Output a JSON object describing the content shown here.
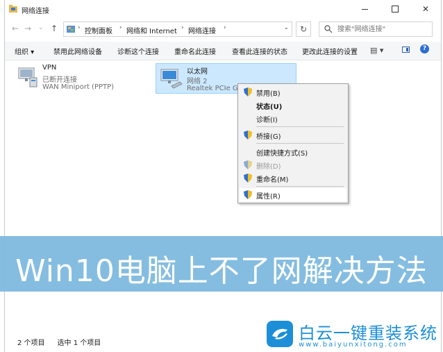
{
  "window": {
    "title": "网络连接",
    "controls": {
      "minimize": "min",
      "maximize": "max",
      "close": "✕"
    }
  },
  "nav": {
    "back": "←",
    "forward": "→",
    "recent": "⌄",
    "up": "↑",
    "breadcrumb": [
      "控制面板",
      "网络和 Internet",
      "网络连接"
    ],
    "refresh": "↻",
    "search_placeholder": "搜索\"网络连接\""
  },
  "commandbar": {
    "organize": "组织 ▾",
    "disable": "禁用此网络设备",
    "diagnose": "诊断这个连接",
    "rename": "重命名此连接",
    "view_status": "查看此连接的状态",
    "change_settings": "更改此连接的设置",
    "view_toggle": "▤ ▾",
    "help": "?"
  },
  "items": [
    {
      "name": "VPN",
      "status": "已断开连接",
      "device": "WAN Miniport (PPTP)",
      "selected": false
    },
    {
      "name": "以太网",
      "status": "网络 2",
      "device": "Realtek PCIe GB",
      "selected": true
    }
  ],
  "context_menu": {
    "items": [
      {
        "label": "禁用(B)",
        "shield": true,
        "bold": false,
        "disabled": false
      },
      {
        "label": "状态(U)",
        "shield": false,
        "bold": true,
        "disabled": false
      },
      {
        "label": "诊断(I)",
        "shield": false,
        "bold": false,
        "disabled": false
      },
      {
        "label": "桥接(G)",
        "shield": true,
        "bold": false,
        "disabled": false
      },
      {
        "label": "创建快捷方式(S)",
        "shield": false,
        "bold": false,
        "disabled": false
      },
      {
        "label": "删除(D)",
        "shield": true,
        "bold": false,
        "disabled": true
      },
      {
        "label": "重命名(M)",
        "shield": true,
        "bold": false,
        "disabled": false
      },
      {
        "label": "属性(R)",
        "shield": true,
        "bold": false,
        "disabled": false
      }
    ]
  },
  "banner": {
    "text": "Win10电脑上不了网解决方法"
  },
  "status": {
    "count": "2 个项目",
    "selected": "选中 1 个项目"
  },
  "watermark": {
    "title": "白云一键重装系统",
    "url": "www.baiyunxitong.com"
  },
  "colors": {
    "selection": "#cce8ff",
    "banner": "#7cb9df",
    "brand": "#1d8fd8"
  }
}
